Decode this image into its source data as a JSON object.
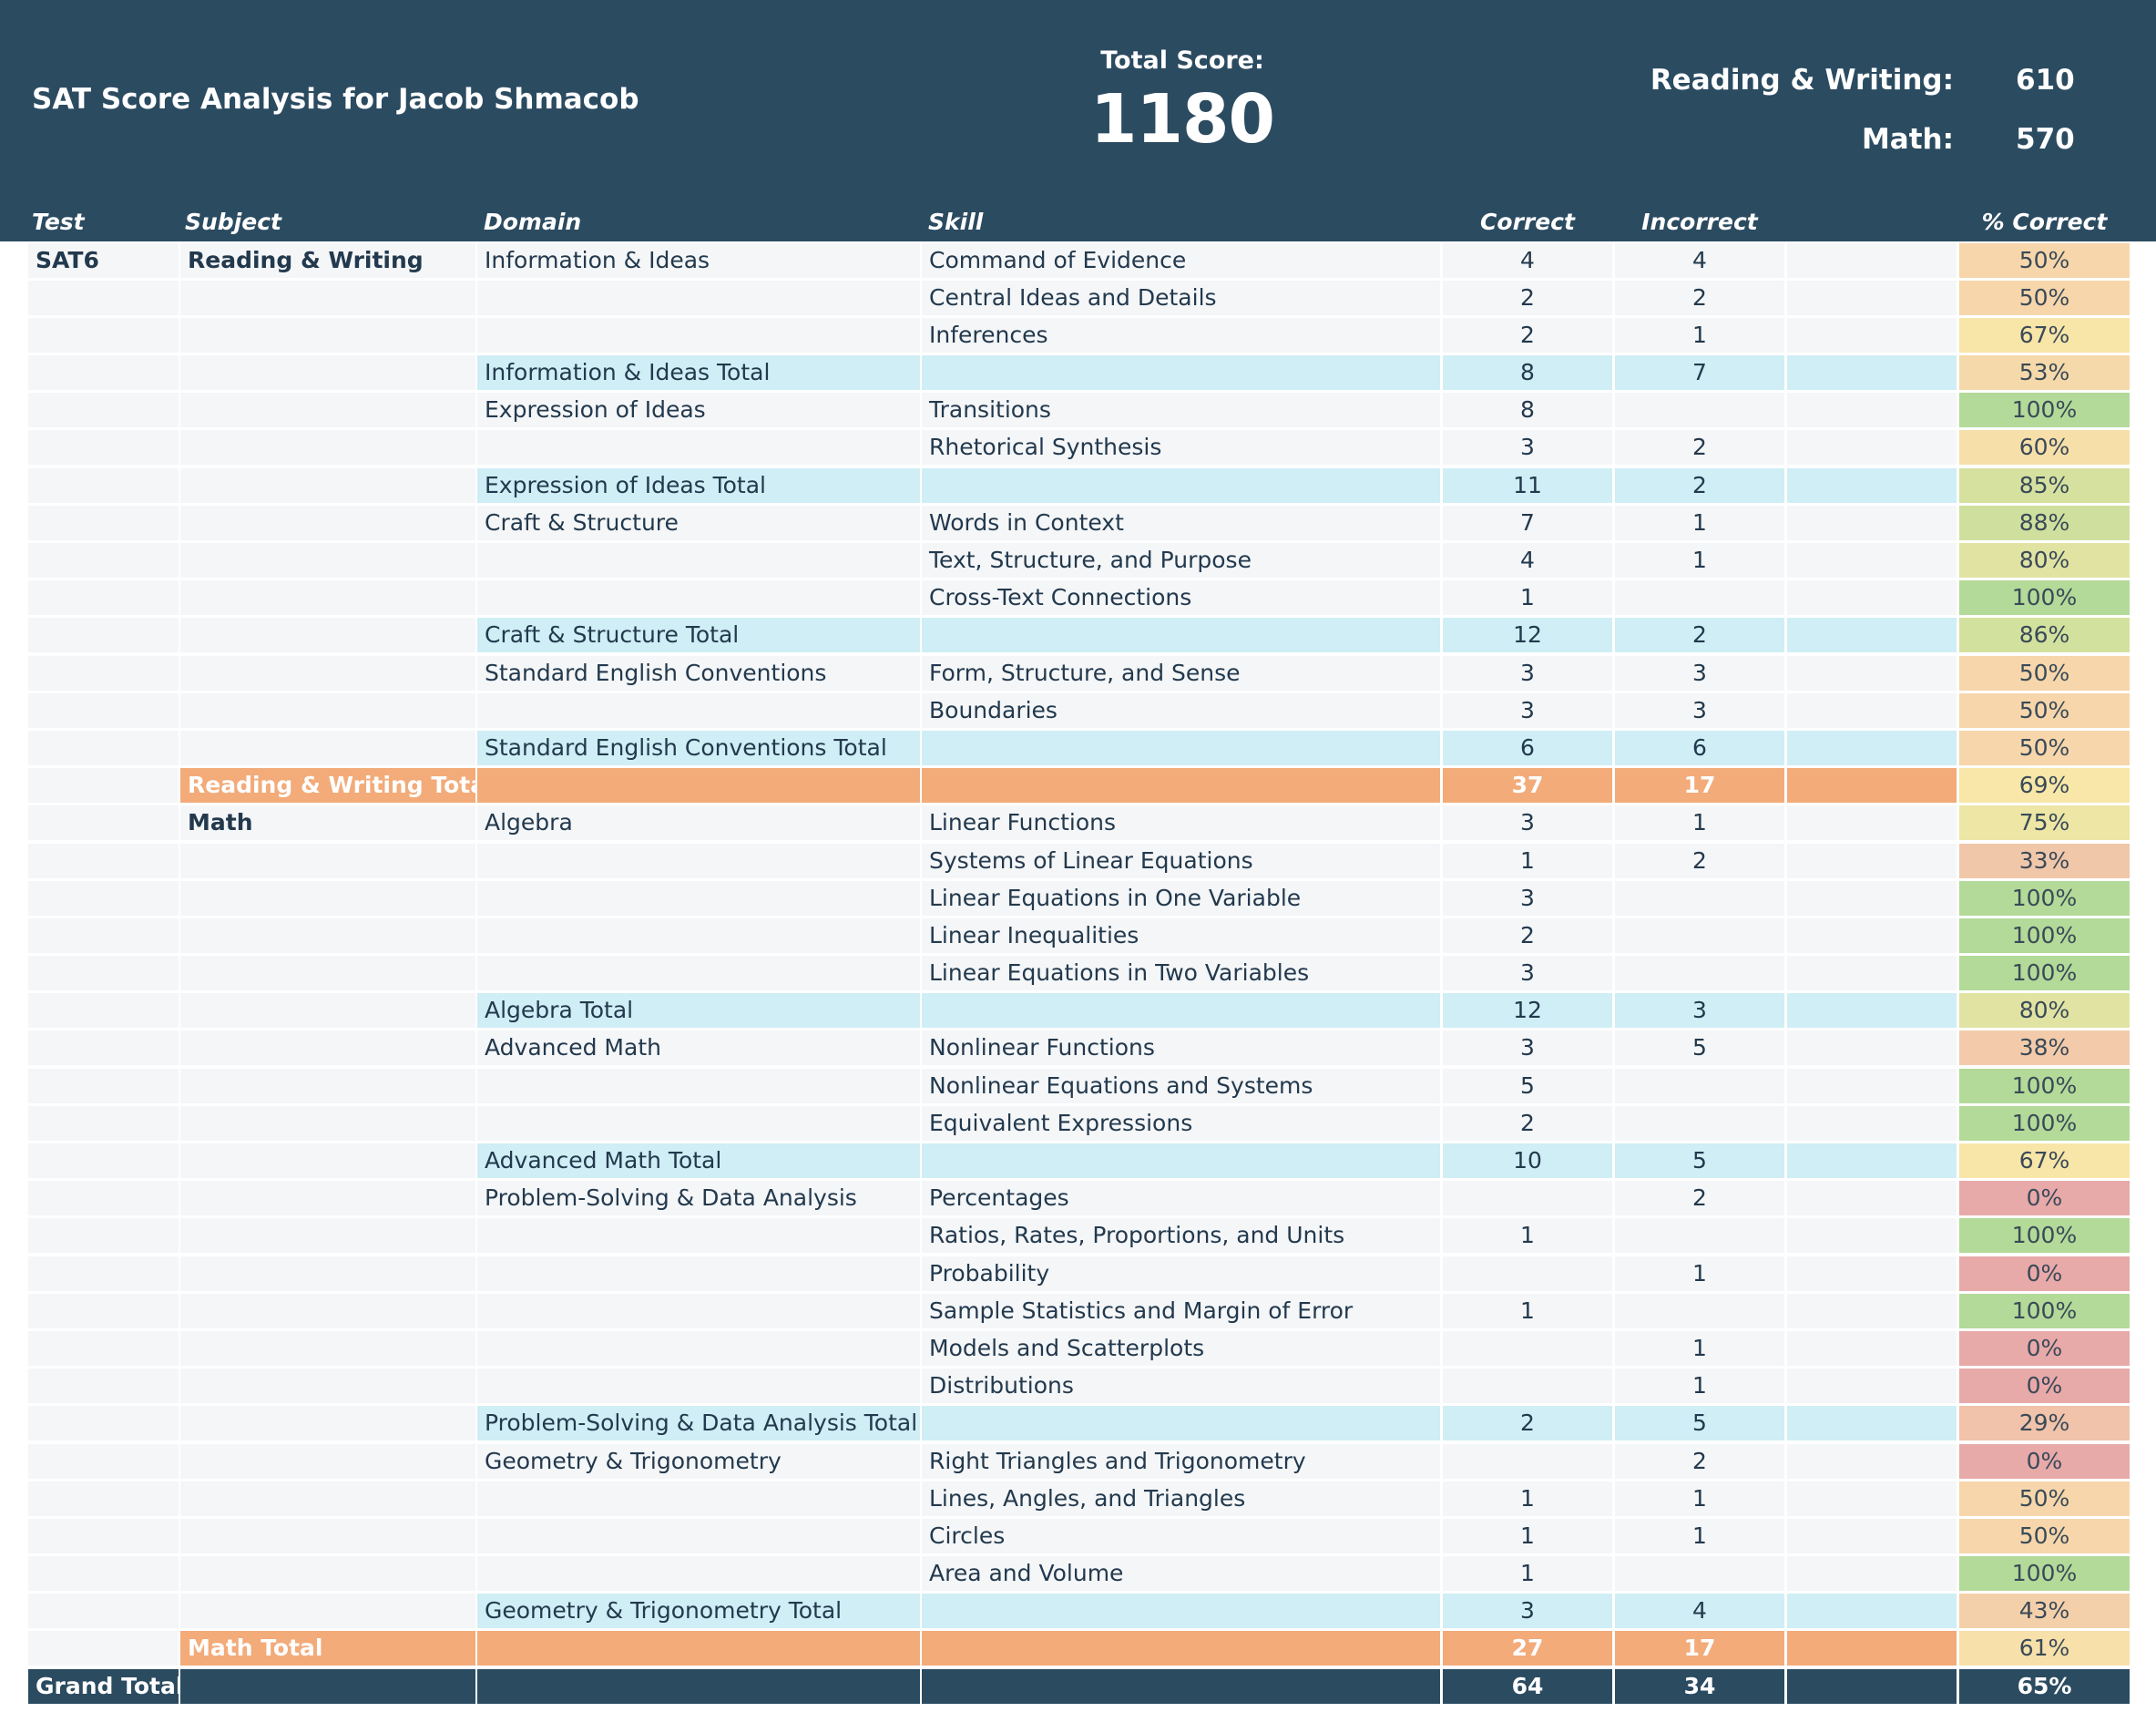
{
  "header": {
    "title": "SAT Score Analysis for Jacob Shmacob",
    "total_label": "Total Score:",
    "total_value": "1180",
    "rw_label": "Reading & Writing:",
    "rw_value": "610",
    "math_label": "Math:",
    "math_value": "570"
  },
  "columns": {
    "test": "Test",
    "subject": "Subject",
    "domain": "Domain",
    "skill": "Skill",
    "correct": "Correct",
    "incorrect": "Incorrect",
    "pct": "% Correct"
  },
  "colors": {
    "header_bg": "#2b4b61",
    "domain_total": "#cfeef5",
    "subject_total": "#f2ab79",
    "pct_scale_low": "#e8a9a9",
    "pct_scale_mid": "#f8e8a8",
    "pct_scale_high": "#b3da98"
  },
  "rows": [
    {
      "type": "skill",
      "test": "SAT6",
      "subject": "Reading & Writing",
      "domain": "Information & Ideas",
      "skill": "Command of Evidence",
      "correct": "4",
      "incorrect": "4",
      "pct": "50%",
      "pct_value": 50
    },
    {
      "type": "skill",
      "test": "",
      "subject": "",
      "domain": "",
      "skill": "Central Ideas and Details",
      "correct": "2",
      "incorrect": "2",
      "pct": "50%",
      "pct_value": 50
    },
    {
      "type": "skill",
      "test": "",
      "subject": "",
      "domain": "",
      "skill": "Inferences",
      "correct": "2",
      "incorrect": "1",
      "pct": "67%",
      "pct_value": 67
    },
    {
      "type": "domain-total",
      "test": "",
      "subject": "",
      "domain": "Information & Ideas Total",
      "skill": "",
      "correct": "8",
      "incorrect": "7",
      "pct": "53%",
      "pct_value": 53
    },
    {
      "type": "skill",
      "test": "",
      "subject": "",
      "domain": "Expression of Ideas",
      "skill": "Transitions",
      "correct": "8",
      "incorrect": "",
      "pct": "100%",
      "pct_value": 100
    },
    {
      "type": "skill",
      "test": "",
      "subject": "",
      "domain": "",
      "skill": "Rhetorical Synthesis",
      "correct": "3",
      "incorrect": "2",
      "pct": "60%",
      "pct_value": 60
    },
    {
      "type": "domain-total",
      "test": "",
      "subject": "",
      "domain": "Expression of Ideas Total",
      "skill": "",
      "correct": "11",
      "incorrect": "2",
      "pct": "85%",
      "pct_value": 85
    },
    {
      "type": "skill",
      "test": "",
      "subject": "",
      "domain": "Craft & Structure",
      "skill": "Words in Context",
      "correct": "7",
      "incorrect": "1",
      "pct": "88%",
      "pct_value": 88
    },
    {
      "type": "skill",
      "test": "",
      "subject": "",
      "domain": "",
      "skill": "Text, Structure, and Purpose",
      "correct": "4",
      "incorrect": "1",
      "pct": "80%",
      "pct_value": 80
    },
    {
      "type": "skill",
      "test": "",
      "subject": "",
      "domain": "",
      "skill": "Cross-Text Connections",
      "correct": "1",
      "incorrect": "",
      "pct": "100%",
      "pct_value": 100
    },
    {
      "type": "domain-total",
      "test": "",
      "subject": "",
      "domain": "Craft & Structure Total",
      "skill": "",
      "correct": "12",
      "incorrect": "2",
      "pct": "86%",
      "pct_value": 86
    },
    {
      "type": "skill",
      "test": "",
      "subject": "",
      "domain": "Standard English Conventions",
      "skill": "Form, Structure, and Sense",
      "correct": "3",
      "incorrect": "3",
      "pct": "50%",
      "pct_value": 50
    },
    {
      "type": "skill",
      "test": "",
      "subject": "",
      "domain": "",
      "skill": "Boundaries",
      "correct": "3",
      "incorrect": "3",
      "pct": "50%",
      "pct_value": 50
    },
    {
      "type": "domain-total",
      "test": "",
      "subject": "",
      "domain": "Standard English Conventions Total",
      "skill": "",
      "correct": "6",
      "incorrect": "6",
      "pct": "50%",
      "pct_value": 50
    },
    {
      "type": "subject-total",
      "test": "",
      "subject": "Reading & Writing Total",
      "domain": "",
      "skill": "",
      "correct": "37",
      "incorrect": "17",
      "pct": "69%",
      "pct_value": 69
    },
    {
      "type": "skill",
      "test": "",
      "subject": "Math",
      "domain": "Algebra",
      "skill": "Linear Functions",
      "correct": "3",
      "incorrect": "1",
      "pct": "75%",
      "pct_value": 75
    },
    {
      "type": "skill",
      "test": "",
      "subject": "",
      "domain": "",
      "skill": "Systems of Linear Equations",
      "correct": "1",
      "incorrect": "2",
      "pct": "33%",
      "pct_value": 33
    },
    {
      "type": "skill",
      "test": "",
      "subject": "",
      "domain": "",
      "skill": "Linear Equations in One Variable",
      "correct": "3",
      "incorrect": "",
      "pct": "100%",
      "pct_value": 100
    },
    {
      "type": "skill",
      "test": "",
      "subject": "",
      "domain": "",
      "skill": "Linear Inequalities",
      "correct": "2",
      "incorrect": "",
      "pct": "100%",
      "pct_value": 100
    },
    {
      "type": "skill",
      "test": "",
      "subject": "",
      "domain": "",
      "skill": "Linear Equations in Two Variables",
      "correct": "3",
      "incorrect": "",
      "pct": "100%",
      "pct_value": 100
    },
    {
      "type": "domain-total",
      "test": "",
      "subject": "",
      "domain": "Algebra Total",
      "skill": "",
      "correct": "12",
      "incorrect": "3",
      "pct": "80%",
      "pct_value": 80
    },
    {
      "type": "skill",
      "test": "",
      "subject": "",
      "domain": "Advanced Math",
      "skill": "Nonlinear Functions",
      "correct": "3",
      "incorrect": "5",
      "pct": "38%",
      "pct_value": 38
    },
    {
      "type": "skill",
      "test": "",
      "subject": "",
      "domain": "",
      "skill": "Nonlinear Equations and Systems",
      "correct": "5",
      "incorrect": "",
      "pct": "100%",
      "pct_value": 100
    },
    {
      "type": "skill",
      "test": "",
      "subject": "",
      "domain": "",
      "skill": "Equivalent Expressions",
      "correct": "2",
      "incorrect": "",
      "pct": "100%",
      "pct_value": 100
    },
    {
      "type": "domain-total",
      "test": "",
      "subject": "",
      "domain": "Advanced Math Total",
      "skill": "",
      "correct": "10",
      "incorrect": "5",
      "pct": "67%",
      "pct_value": 67
    },
    {
      "type": "skill",
      "test": "",
      "subject": "",
      "domain": "Problem-Solving & Data Analysis",
      "skill": "Percentages",
      "correct": "",
      "incorrect": "2",
      "pct": "0%",
      "pct_value": 0
    },
    {
      "type": "skill",
      "test": "",
      "subject": "",
      "domain": "",
      "skill": "Ratios, Rates, Proportions, and Units",
      "correct": "1",
      "incorrect": "",
      "pct": "100%",
      "pct_value": 100
    },
    {
      "type": "skill",
      "test": "",
      "subject": "",
      "domain": "",
      "skill": "Probability",
      "correct": "",
      "incorrect": "1",
      "pct": "0%",
      "pct_value": 0
    },
    {
      "type": "skill",
      "test": "",
      "subject": "",
      "domain": "",
      "skill": "Sample Statistics and Margin of Error",
      "correct": "1",
      "incorrect": "",
      "pct": "100%",
      "pct_value": 100
    },
    {
      "type": "skill",
      "test": "",
      "subject": "",
      "domain": "",
      "skill": "Models and Scatterplots",
      "correct": "",
      "incorrect": "1",
      "pct": "0%",
      "pct_value": 0
    },
    {
      "type": "skill",
      "test": "",
      "subject": "",
      "domain": "",
      "skill": "Distributions",
      "correct": "",
      "incorrect": "1",
      "pct": "0%",
      "pct_value": 0
    },
    {
      "type": "domain-total",
      "test": "",
      "subject": "",
      "domain": "Problem-Solving & Data Analysis Total",
      "skill": "",
      "correct": "2",
      "incorrect": "5",
      "pct": "29%",
      "pct_value": 29
    },
    {
      "type": "skill",
      "test": "",
      "subject": "",
      "domain": "Geometry & Trigonometry",
      "skill": "Right Triangles and Trigonometry",
      "correct": "",
      "incorrect": "2",
      "pct": "0%",
      "pct_value": 0
    },
    {
      "type": "skill",
      "test": "",
      "subject": "",
      "domain": "",
      "skill": "Lines, Angles, and Triangles",
      "correct": "1",
      "incorrect": "1",
      "pct": "50%",
      "pct_value": 50
    },
    {
      "type": "skill",
      "test": "",
      "subject": "",
      "domain": "",
      "skill": "Circles",
      "correct": "1",
      "incorrect": "1",
      "pct": "50%",
      "pct_value": 50
    },
    {
      "type": "skill",
      "test": "",
      "subject": "",
      "domain": "",
      "skill": "Area and Volume",
      "correct": "1",
      "incorrect": "",
      "pct": "100%",
      "pct_value": 100
    },
    {
      "type": "domain-total",
      "test": "",
      "subject": "",
      "domain": "Geometry & Trigonometry Total",
      "skill": "",
      "correct": "3",
      "incorrect": "4",
      "pct": "43%",
      "pct_value": 43
    },
    {
      "type": "subject-total",
      "test": "",
      "subject": "Math Total",
      "domain": "",
      "skill": "",
      "correct": "27",
      "incorrect": "17",
      "pct": "61%",
      "pct_value": 61
    },
    {
      "type": "grand",
      "test": "Grand Total",
      "subject": "",
      "domain": "",
      "skill": "",
      "correct": "64",
      "incorrect": "34",
      "pct": "65%",
      "pct_value": 65
    }
  ]
}
